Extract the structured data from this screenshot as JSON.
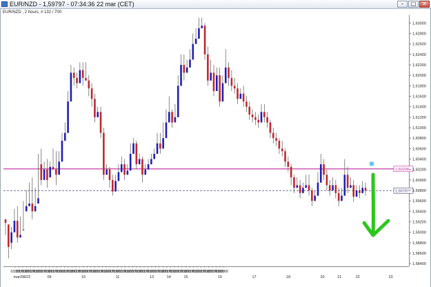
{
  "window": {
    "title": "EUR/NZD - 1,59797 - 07:34:36  22 mar (CET)",
    "subtitle": "EUR/NZD , 2 hours, # 132 / 700",
    "buttons": [
      "–",
      "□",
      "✕"
    ]
  },
  "chart_data": {
    "type": "candlestick",
    "symbol": "EUR/NZD",
    "timeframe": "2 hours",
    "ylim": [
      1.5835,
      1.6315
    ],
    "y_ticks": [
      "1,63000",
      "1,62800",
      "1,62600",
      "1,62400",
      "1,62200",
      "1,62000",
      "1,61800",
      "1,61600",
      "1,61400",
      "1,61200",
      "1,61000",
      "1,60800",
      "1,60600",
      "1,60400",
      "1,60200",
      "1,60000",
      "1,59800",
      "1,59600",
      "1,59400",
      "1,59200",
      "1,59000",
      "1,58800",
      "1,58600",
      "1,58400"
    ],
    "y_tick_values": [
      1.63,
      1.628,
      1.626,
      1.624,
      1.622,
      1.62,
      1.618,
      1.616,
      1.614,
      1.612,
      1.61,
      1.608,
      1.606,
      1.604,
      1.602,
      1.6,
      1.598,
      1.596,
      1.594,
      1.592,
      1.59,
      1.588,
      1.586,
      1.584
    ],
    "x_time_labels": [
      "01:00",
      "09:00",
      "17:00",
      "01:00",
      "09:00",
      "17:00",
      "01:00",
      "09:00",
      "17:00",
      "01:00",
      "09:00",
      "17:00",
      "01:00",
      "09:00",
      "17:00",
      "01:00",
      "09:00",
      "17:00",
      "01:00",
      "09:00",
      "17:00",
      "01:00",
      "09:00",
      "17:00",
      "01:00",
      "09:00",
      "17:00",
      "01:00",
      "09:00",
      "17:00",
      "01:00",
      "09:00",
      "17:00",
      "01:00",
      "09:00",
      "17:00",
      "01:00",
      "09:00",
      "17:00",
      "01:00",
      "09:00",
      "17:00",
      "01:00",
      "09:00",
      "17:00",
      "01:00",
      "09:00",
      "17:00",
      "01:00",
      "09:00",
      "17:00",
      "01:00",
      "09:00",
      "17:00",
      "01:00",
      "09:00"
    ],
    "x_date_labels": [
      {
        "label": "mar/08/22",
        "slot": 0.6
      },
      {
        "label": "09",
        "slot": 3
      },
      {
        "label": "10",
        "slot": 6
      },
      {
        "label": "11",
        "slot": 9
      },
      {
        "label": "13",
        "slot": 12
      },
      {
        "label": "14",
        "slot": 13.5
      },
      {
        "label": "15",
        "slot": 15
      },
      {
        "label": "16",
        "slot": 18
      },
      {
        "label": "17",
        "slot": 21
      },
      {
        "label": "18",
        "slot": 24
      },
      {
        "label": "20",
        "slot": 27
      },
      {
        "label": "21",
        "slot": 28.5
      },
      {
        "label": "22",
        "slot": 30.1
      },
      {
        "label": "23",
        "slot": 33
      }
    ],
    "horizontal_lines": [
      {
        "value": 1.60212,
        "label": "1,60208",
        "color": "#c0259b",
        "style": "solid"
      },
      {
        "value": 1.59797,
        "label": "1,59797",
        "color": "#40407a",
        "style": "dashed"
      }
    ],
    "marker": {
      "value": 1.6031,
      "color": "#66c6ee"
    },
    "arrow_color": "#2cc61c",
    "up_color": "#1f1fb4",
    "down_color": "#c0272d",
    "candles": [
      [
        1.5925,
        1.5912,
        1.5918,
        1.5895
      ],
      [
        1.5915,
        1.5898,
        1.5872,
        1.585
      ],
      [
        1.588,
        1.5868,
        1.59,
        1.591
      ],
      [
        1.59,
        1.5935,
        1.5922,
        1.5945
      ],
      [
        1.5922,
        1.595,
        1.589,
        1.588
      ],
      [
        1.589,
        1.593,
        1.5895,
        1.591
      ],
      [
        1.5905,
        1.596,
        1.5905,
        1.594
      ],
      [
        1.594,
        1.598,
        1.595,
        1.5965
      ],
      [
        1.595,
        1.5995,
        1.5955,
        1.5975
      ],
      [
        1.5955,
        1.6005,
        1.594,
        1.5925
      ],
      [
        1.594,
        1.5985,
        1.595,
        1.596
      ],
      [
        1.5955,
        1.605,
        1.5965,
        1.603
      ],
      [
        1.603,
        1.606,
        1.6,
        1.599
      ],
      [
        1.6,
        1.603,
        1.602,
        1.6035
      ],
      [
        1.602,
        1.604,
        1.6,
        1.5985
      ],
      [
        1.6005,
        1.603,
        1.6025,
        1.6035
      ],
      [
        1.6025,
        1.606,
        1.602,
        1.6045
      ],
      [
        1.602,
        1.6055,
        1.601,
        1.599
      ],
      [
        1.601,
        1.6045,
        1.6035,
        1.6055
      ],
      [
        1.6035,
        1.6085,
        1.6075,
        1.609
      ],
      [
        1.6075,
        1.611,
        1.609,
        1.6105
      ],
      [
        1.609,
        1.616,
        1.615,
        1.617
      ],
      [
        1.615,
        1.6215,
        1.6205,
        1.622
      ],
      [
        1.6205,
        1.6215,
        1.6195,
        1.618
      ],
      [
        1.6195,
        1.6205,
        1.6185,
        1.6175
      ],
      [
        1.6185,
        1.622,
        1.621,
        1.6225
      ],
      [
        1.621,
        1.6225,
        1.6195,
        1.618
      ],
      [
        1.6195,
        1.6225,
        1.619,
        1.6215
      ],
      [
        1.619,
        1.62,
        1.6175,
        1.616
      ],
      [
        1.6175,
        1.6185,
        1.6155,
        1.614
      ],
      [
        1.6155,
        1.6165,
        1.612,
        1.611
      ],
      [
        1.612,
        1.6135,
        1.613,
        1.614
      ],
      [
        1.613,
        1.614,
        1.609,
        1.608
      ],
      [
        1.609,
        1.61,
        1.601,
        1.6
      ],
      [
        1.601,
        1.603,
        1.602,
        1.603
      ],
      [
        1.602,
        1.6025,
        1.6,
        1.5985
      ],
      [
        1.6,
        1.601,
        1.5978,
        1.597
      ],
      [
        1.5978,
        1.6005,
        1.5998,
        1.601
      ],
      [
        1.5998,
        1.6025,
        1.6015,
        1.603
      ],
      [
        1.6015,
        1.604,
        1.603,
        1.6045
      ],
      [
        1.603,
        1.604,
        1.601,
        1.6
      ],
      [
        1.601,
        1.6025,
        1.6018,
        1.603
      ],
      [
        1.6018,
        1.606,
        1.605,
        1.607
      ],
      [
        1.605,
        1.6075,
        1.607,
        1.608
      ],
      [
        1.607,
        1.6075,
        1.603,
        1.602
      ],
      [
        1.603,
        1.6045,
        1.604,
        1.605
      ],
      [
        1.604,
        1.6045,
        1.601,
        1.5995
      ],
      [
        1.601,
        1.6025,
        1.602,
        1.603
      ],
      [
        1.602,
        1.6035,
        1.603,
        1.604
      ],
      [
        1.603,
        1.6045,
        1.604,
        1.605
      ],
      [
        1.604,
        1.6055,
        1.605,
        1.606
      ],
      [
        1.605,
        1.608,
        1.607,
        1.609
      ],
      [
        1.607,
        1.609,
        1.606,
        1.605
      ],
      [
        1.606,
        1.61,
        1.608,
        1.611
      ],
      [
        1.608,
        1.6125,
        1.611,
        1.6135
      ],
      [
        1.611,
        1.615,
        1.613,
        1.616
      ],
      [
        1.613,
        1.6135,
        1.611,
        1.61
      ],
      [
        1.611,
        1.6135,
        1.612,
        1.6145
      ],
      [
        1.612,
        1.619,
        1.618,
        1.62
      ],
      [
        1.618,
        1.623,
        1.622,
        1.624
      ],
      [
        1.622,
        1.624,
        1.6205,
        1.619
      ],
      [
        1.6205,
        1.6225,
        1.6215,
        1.623
      ],
      [
        1.6215,
        1.624,
        1.623,
        1.625
      ],
      [
        1.623,
        1.627,
        1.626,
        1.628
      ],
      [
        1.626,
        1.628,
        1.627,
        1.629
      ],
      [
        1.627,
        1.63,
        1.629,
        1.631
      ],
      [
        1.629,
        1.631,
        1.6295,
        1.6305
      ],
      [
        1.6295,
        1.63,
        1.624,
        1.623
      ],
      [
        1.624,
        1.6255,
        1.619,
        1.618
      ],
      [
        1.619,
        1.622,
        1.6205,
        1.623
      ],
      [
        1.6205,
        1.622,
        1.617,
        1.616
      ],
      [
        1.617,
        1.621,
        1.62,
        1.6215
      ],
      [
        1.62,
        1.6215,
        1.615,
        1.614
      ],
      [
        1.615,
        1.619,
        1.6185,
        1.62
      ],
      [
        1.6185,
        1.625,
        1.6215,
        1.62
      ],
      [
        1.6215,
        1.6225,
        1.6195,
        1.618
      ],
      [
        1.6195,
        1.621,
        1.618,
        1.617
      ],
      [
        1.618,
        1.6195,
        1.6175,
        1.6165
      ],
      [
        1.6175,
        1.6185,
        1.6155,
        1.6145
      ],
      [
        1.6155,
        1.617,
        1.6165,
        1.6175
      ],
      [
        1.6165,
        1.618,
        1.615,
        1.614
      ],
      [
        1.615,
        1.616,
        1.614,
        1.613
      ],
      [
        1.614,
        1.615,
        1.6125,
        1.6115
      ],
      [
        1.6125,
        1.6135,
        1.612,
        1.611
      ],
      [
        1.612,
        1.613,
        1.6115,
        1.6105
      ],
      [
        1.6115,
        1.6125,
        1.611,
        1.61
      ],
      [
        1.611,
        1.614,
        1.613,
        1.6145
      ],
      [
        1.613,
        1.6145,
        1.612,
        1.611
      ],
      [
        1.612,
        1.613,
        1.611,
        1.61
      ],
      [
        1.611,
        1.6115,
        1.609,
        1.608
      ],
      [
        1.609,
        1.61,
        1.608,
        1.607
      ],
      [
        1.608,
        1.609,
        1.6075,
        1.6065
      ],
      [
        1.6075,
        1.608,
        1.606,
        1.605
      ],
      [
        1.606,
        1.6075,
        1.6055,
        1.6045
      ],
      [
        1.6055,
        1.606,
        1.6035,
        1.6025
      ],
      [
        1.6035,
        1.6045,
        1.6025,
        1.6015
      ],
      [
        1.6025,
        1.603,
        1.6005,
        1.599
      ],
      [
        1.6005,
        1.601,
        1.5985,
        1.5975
      ],
      [
        1.5985,
        1.6,
        1.599,
        1.6005
      ],
      [
        1.599,
        1.6,
        1.5975,
        1.5965
      ],
      [
        1.5975,
        1.599,
        1.5985,
        1.5995
      ],
      [
        1.5985,
        1.6,
        1.599,
        1.601
      ],
      [
        1.599,
        1.601,
        1.598,
        1.597
      ],
      [
        1.598,
        1.5985,
        1.596,
        1.595
      ],
      [
        1.596,
        1.5975,
        1.597,
        1.598
      ],
      [
        1.597,
        1.6,
        1.5995,
        1.6015
      ],
      [
        1.5995,
        1.604,
        1.603,
        1.605
      ],
      [
        1.603,
        1.604,
        1.601,
        1.6
      ],
      [
        1.601,
        1.602,
        1.599,
        1.598
      ],
      [
        1.599,
        1.6,
        1.598,
        1.597
      ],
      [
        1.598,
        1.5995,
        1.599,
        1.6005
      ],
      [
        1.599,
        1.6,
        1.5975,
        1.5965
      ],
      [
        1.5975,
        1.5985,
        1.596,
        1.595
      ],
      [
        1.596,
        1.5975,
        1.597,
        1.5985
      ],
      [
        1.597,
        1.603,
        1.601,
        1.604
      ],
      [
        1.601,
        1.6025,
        1.5985,
        1.5975
      ],
      [
        1.5985,
        1.5998,
        1.599,
        1.6005
      ],
      [
        1.599,
        1.6,
        1.5968,
        1.5958
      ],
      [
        1.5968,
        1.5985,
        1.598,
        1.599
      ],
      [
        1.598,
        1.599,
        1.5975,
        1.5965
      ],
      [
        1.5975,
        1.599,
        1.5985,
        1.5998
      ],
      [
        1.5985,
        1.5995,
        1.598,
        1.597
      ]
    ]
  }
}
